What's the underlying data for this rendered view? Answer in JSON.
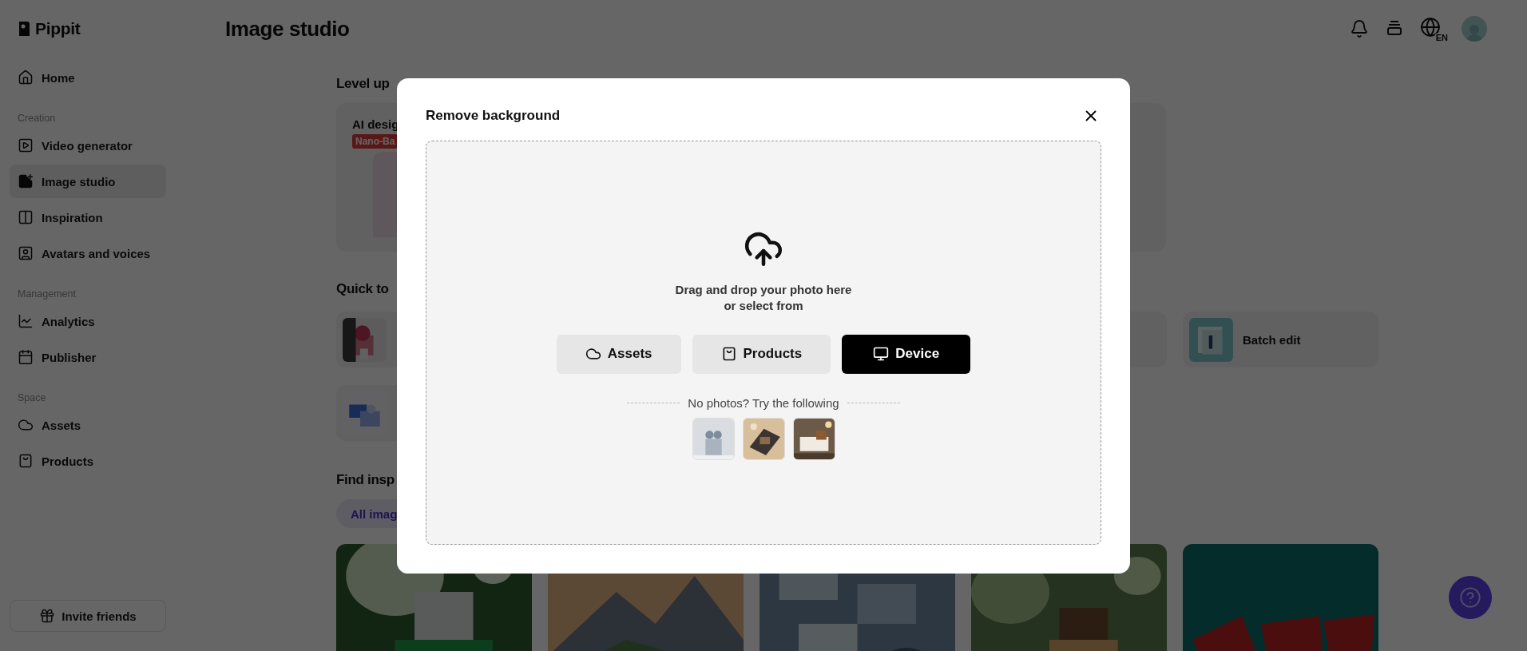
{
  "sidebar": {
    "logo": "Pippit",
    "nav": [
      {
        "label": "Home",
        "selected": false
      }
    ],
    "sections": [
      {
        "title": "Creation",
        "items": [
          {
            "label": "Video generator",
            "selected": false
          },
          {
            "label": "Image studio",
            "selected": true
          },
          {
            "label": "Inspiration",
            "selected": false
          },
          {
            "label": "Avatars and voices",
            "selected": false
          }
        ]
      },
      {
        "title": "Management",
        "items": [
          {
            "label": "Analytics",
            "selected": false
          },
          {
            "label": "Publisher",
            "selected": false
          }
        ]
      },
      {
        "title": "Space",
        "items": [
          {
            "label": "Assets",
            "selected": false
          },
          {
            "label": "Products",
            "selected": false
          }
        ]
      }
    ],
    "invite_button": "Invite friends"
  },
  "header": {
    "title": "Image studio",
    "language": "EN"
  },
  "level_up": {
    "heading": "Level up",
    "card_title": "AI desig",
    "card_badge": "Nano-Ba"
  },
  "quick_tools": {
    "heading": "Quick to",
    "cards": [
      {
        "kind": "thumbnail"
      },
      {
        "kind": "plain"
      },
      {
        "kind": "labeled",
        "label": "Batch edit"
      },
      {
        "kind": "thumbnail"
      }
    ]
  },
  "inspiration": {
    "heading": "Find insp",
    "filter": {
      "label": "All imag",
      "selected": true
    }
  },
  "modal": {
    "title": "Remove background",
    "prompt_line1": "Drag and drop your photo here",
    "prompt_line2": "or select from",
    "buttons": [
      {
        "label": "Assets",
        "kind": "secondary"
      },
      {
        "label": "Products",
        "kind": "secondary"
      },
      {
        "label": "Device",
        "kind": "primary"
      }
    ],
    "samples_label": "No photos? Try the following"
  }
}
